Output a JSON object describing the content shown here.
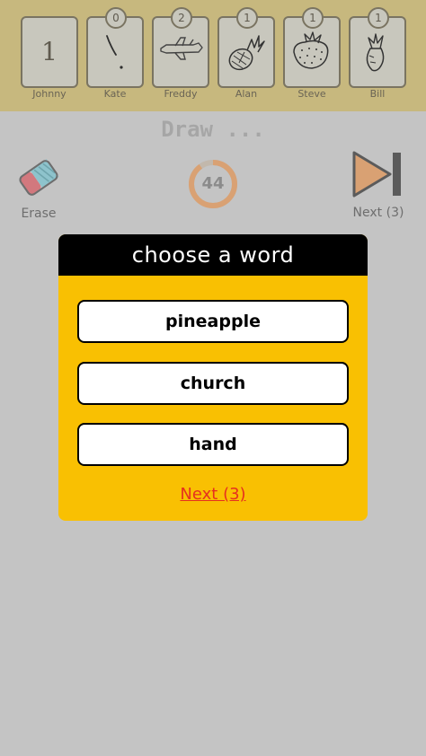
{
  "players": [
    {
      "name": "Johnny",
      "rank": "1",
      "score": null,
      "drawing": "blank"
    },
    {
      "name": "Kate",
      "rank": null,
      "score": "0",
      "drawing": "scribble-drawing"
    },
    {
      "name": "Freddy",
      "rank": null,
      "score": "2",
      "drawing": "airplane-drawing"
    },
    {
      "name": "Alan",
      "rank": null,
      "score": "1",
      "drawing": "pineapple-drawing"
    },
    {
      "name": "Steve",
      "rank": null,
      "score": "1",
      "drawing": "strawberry-drawing"
    },
    {
      "name": "Bill",
      "rank": null,
      "score": "1",
      "drawing": "radish-drawing"
    }
  ],
  "draw_area": {
    "title": "Draw ...",
    "erase_label": "Erase",
    "timer": "44",
    "next_label": "Next (3)"
  },
  "modal": {
    "title": "choose a word",
    "words": [
      "pineapple",
      "church",
      "hand"
    ],
    "next_link": "Next (3)"
  },
  "colors": {
    "player_bar": "#c7b87e",
    "background": "#c4c4c4",
    "modal_bg": "#f9c002",
    "modal_header": "#000000",
    "next_link": "#e6301f",
    "timer_ring": "#d9a173",
    "next_arrow": "#d9a173"
  }
}
